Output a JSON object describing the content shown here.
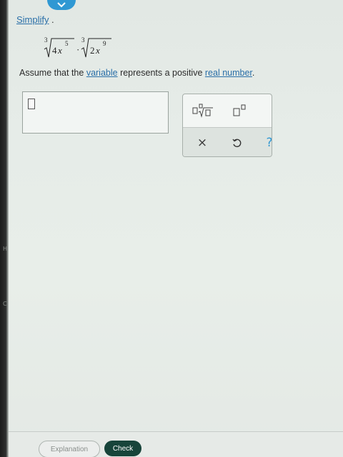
{
  "header": {
    "collapse_icon": "chevron-down-icon",
    "accent_color": "#2f98d3"
  },
  "question": {
    "instruction": "Simplify",
    "instruction_end": ".",
    "expression": {
      "root1": {
        "index": "3",
        "coefficient": "4",
        "variable": "x",
        "exponent": "5"
      },
      "operator": "·",
      "root2": {
        "index": "3",
        "coefficient": "2",
        "variable": "x",
        "exponent": "9"
      }
    },
    "assumption": {
      "prefix": "Assume that the ",
      "link1": "variable",
      "middle": " represents a positive ",
      "link2": "real number",
      "suffix": "."
    }
  },
  "answer": {
    "value": ""
  },
  "keypad": {
    "buttons": {
      "nth_root": "nth-root-template-icon",
      "superscript": "superscript-template-icon",
      "clear": "×",
      "undo": "undo-icon",
      "help": "?"
    },
    "colors": {
      "clear": "#3a3a3a",
      "undo": "#333333",
      "help": "#2f98d3"
    }
  },
  "footer": {
    "explanation_label": "Explanation",
    "check_label": "Check",
    "check_color": "#17443a"
  },
  "bezel": {
    "mark1": "H",
    "mark2": "C"
  }
}
